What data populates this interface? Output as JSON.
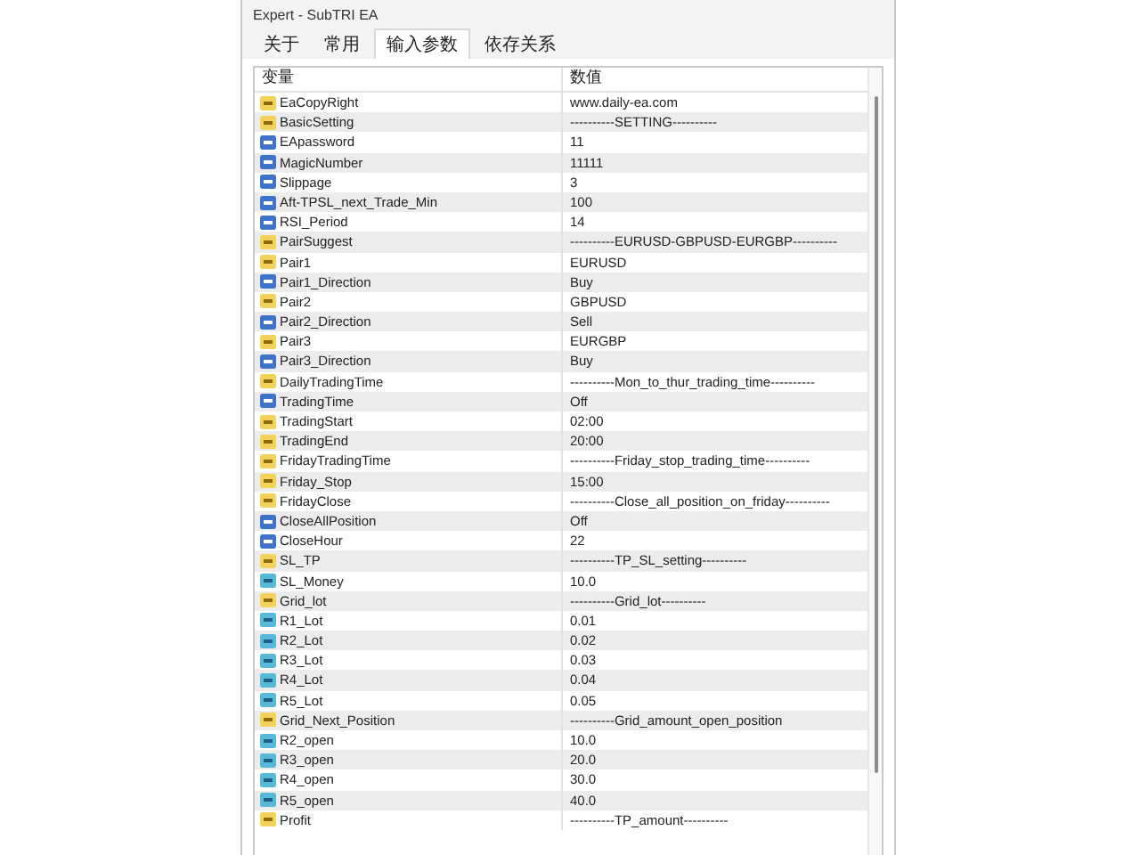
{
  "window": {
    "title": "Expert - SubTRI EA"
  },
  "tabs": [
    {
      "label": "关于",
      "selected": false
    },
    {
      "label": "常用",
      "selected": false
    },
    {
      "label": "输入参数",
      "selected": true
    },
    {
      "label": "依存关系",
      "selected": false
    }
  ],
  "table": {
    "columns": [
      "变量",
      "数值"
    ],
    "rows": [
      {
        "kind": "string",
        "name": "EaCopyRight",
        "value": "www.daily-ea.com"
      },
      {
        "kind": "string",
        "name": "BasicSetting",
        "value": "----------SETTING----------"
      },
      {
        "kind": "int",
        "name": "EApassword",
        "value": "11"
      },
      {
        "kind": "int",
        "name": "MagicNumber",
        "value": "11111"
      },
      {
        "kind": "int",
        "name": "Slippage",
        "value": "3"
      },
      {
        "kind": "int",
        "name": "Aft-TPSL_next_Trade_Min",
        "value": "100"
      },
      {
        "kind": "int",
        "name": "RSI_Period",
        "value": "14"
      },
      {
        "kind": "string",
        "name": "PairSuggest",
        "value": "----------EURUSD-GBPUSD-EURGBP----------"
      },
      {
        "kind": "string",
        "name": "Pair1",
        "value": "EURUSD"
      },
      {
        "kind": "int",
        "name": "Pair1_Direction",
        "value": "Buy"
      },
      {
        "kind": "string",
        "name": "Pair2",
        "value": "GBPUSD"
      },
      {
        "kind": "int",
        "name": "Pair2_Direction",
        "value": "Sell"
      },
      {
        "kind": "string",
        "name": "Pair3",
        "value": "EURGBP"
      },
      {
        "kind": "int",
        "name": "Pair3_Direction",
        "value": "Buy"
      },
      {
        "kind": "string",
        "name": "DailyTradingTime",
        "value": "----------Mon_to_thur_trading_time----------"
      },
      {
        "kind": "int",
        "name": "TradingTime",
        "value": "Off"
      },
      {
        "kind": "string",
        "name": "TradingStart",
        "value": "02:00"
      },
      {
        "kind": "string",
        "name": "TradingEnd",
        "value": "20:00"
      },
      {
        "kind": "string",
        "name": "FridayTradingTime",
        "value": "----------Friday_stop_trading_time----------"
      },
      {
        "kind": "string",
        "name": "Friday_Stop",
        "value": "15:00"
      },
      {
        "kind": "string",
        "name": "FridayClose",
        "value": "----------Close_all_position_on_friday----------"
      },
      {
        "kind": "int",
        "name": "CloseAllPosition",
        "value": "Off"
      },
      {
        "kind": "int",
        "name": "CloseHour",
        "value": "22"
      },
      {
        "kind": "string",
        "name": "SL_TP",
        "value": "----------TP_SL_setting----------"
      },
      {
        "kind": "double",
        "name": "SL_Money",
        "value": "10.0"
      },
      {
        "kind": "string",
        "name": "Grid_lot",
        "value": "----------Grid_lot----------"
      },
      {
        "kind": "double",
        "name": "R1_Lot",
        "value": "0.01"
      },
      {
        "kind": "double",
        "name": "R2_Lot",
        "value": "0.02"
      },
      {
        "kind": "double",
        "name": "R3_Lot",
        "value": "0.03"
      },
      {
        "kind": "double",
        "name": "R4_Lot",
        "value": "0.04"
      },
      {
        "kind": "double",
        "name": "R5_Lot",
        "value": "0.05"
      },
      {
        "kind": "string",
        "name": "Grid_Next_Position",
        "value": "----------Grid_amount_open_position"
      },
      {
        "kind": "double",
        "name": "R2_open",
        "value": "10.0"
      },
      {
        "kind": "double",
        "name": "R3_open",
        "value": "20.0"
      },
      {
        "kind": "double",
        "name": "R4_open",
        "value": "30.0"
      },
      {
        "kind": "double",
        "name": "R5_open",
        "value": "40.0"
      },
      {
        "kind": "string",
        "name": "Profit",
        "value": "----------TP_amount----------"
      }
    ]
  }
}
